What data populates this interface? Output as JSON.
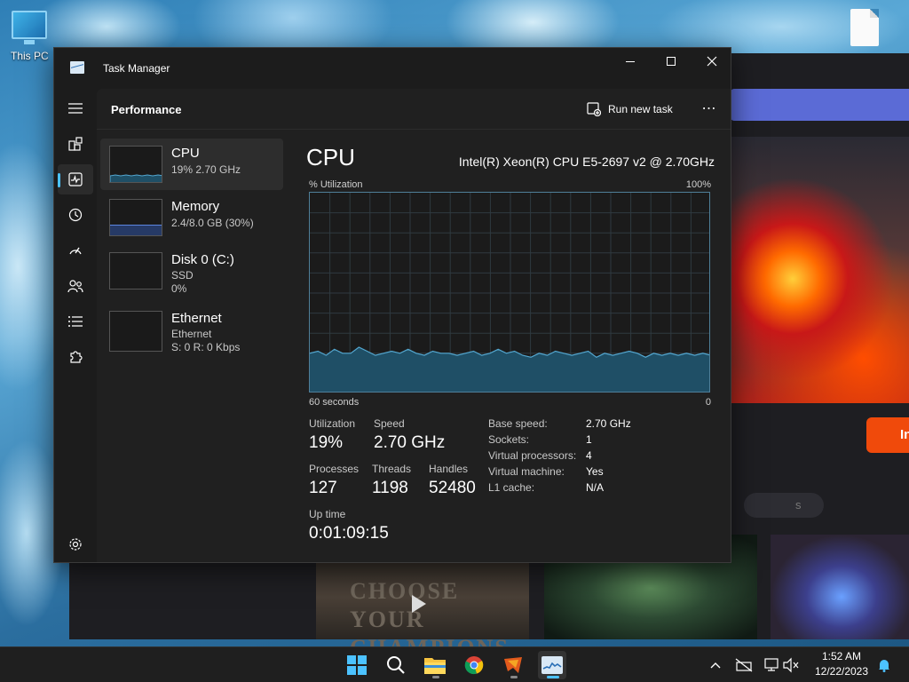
{
  "desktop": {
    "icons": [
      {
        "label": "This PC",
        "icon": "this-pc-icon"
      },
      {
        "label": "",
        "icon": "document-icon"
      }
    ]
  },
  "background_app": {
    "button_label": "In",
    "pill_label": "s",
    "thumbnail_title": "CHOOSE YOUR CHAMPIONS"
  },
  "window": {
    "title": "Task Manager",
    "controls": {
      "minimize": "minimize-icon",
      "maximize": "maximize-icon",
      "close": "close-icon"
    }
  },
  "nav": {
    "items": [
      {
        "name": "hamburger-menu-icon"
      },
      {
        "name": "processes-icon"
      },
      {
        "name": "performance-icon",
        "active": true
      },
      {
        "name": "app-history-icon"
      },
      {
        "name": "startup-apps-icon"
      },
      {
        "name": "users-icon"
      },
      {
        "name": "details-icon"
      },
      {
        "name": "services-icon"
      }
    ],
    "settings": "settings-icon"
  },
  "header": {
    "title": "Performance",
    "run_new_task": "Run new task",
    "more": "⋯"
  },
  "devices": [
    {
      "name": "CPU",
      "line1": "19%  2.70 GHz",
      "line2": ""
    },
    {
      "name": "Memory",
      "line1": "2.4/8.0 GB (30%)",
      "line2": ""
    },
    {
      "name": "Disk 0 (C:)",
      "line1": "SSD",
      "line2": "0%"
    },
    {
      "name": "Ethernet",
      "line1": "Ethernet",
      "line2": "S: 0  R: 0 Kbps"
    }
  ],
  "cpu": {
    "title": "CPU",
    "model": "Intel(R) Xeon(R) CPU E5-2697 v2 @ 2.70GHz",
    "graph": {
      "y_label": "% Utilization",
      "y_max_label": "100%",
      "x_label": "60 seconds",
      "x_min_label": "0",
      "history": [
        20,
        21,
        19,
        22,
        20,
        20,
        23,
        21,
        19,
        20,
        21,
        20,
        22,
        20,
        19,
        21,
        20,
        20,
        19,
        20,
        21,
        19,
        20,
        22,
        20,
        21,
        19,
        18,
        20,
        19,
        21,
        20,
        19,
        20,
        21,
        18,
        20,
        19,
        20,
        21,
        20,
        18,
        20,
        19,
        20,
        19,
        20,
        19,
        20,
        19
      ]
    },
    "stats": {
      "utilization_label": "Utilization",
      "utilization": "19%",
      "speed_label": "Speed",
      "speed": "2.70 GHz",
      "processes_label": "Processes",
      "processes": "127",
      "threads_label": "Threads",
      "threads": "1198",
      "handles_label": "Handles",
      "handles": "52480",
      "uptime_label": "Up time",
      "uptime": "0:01:09:15"
    },
    "details": [
      {
        "key": "Base speed:",
        "value": "2.70 GHz"
      },
      {
        "key": "Sockets:",
        "value": "1"
      },
      {
        "key": "Virtual processors:",
        "value": "4"
      },
      {
        "key": "Virtual machine:",
        "value": "Yes"
      },
      {
        "key": "L1 cache:",
        "value": "N/A"
      }
    ]
  },
  "taskbar": {
    "apps": [
      {
        "name": "start-icon"
      },
      {
        "name": "search-icon"
      },
      {
        "name": "file-explorer-icon"
      },
      {
        "name": "chrome-icon"
      },
      {
        "name": "game-launcher-icon"
      },
      {
        "name": "task-manager-icon",
        "active": true
      }
    ],
    "tray": [
      "chevron-up-icon",
      "network-off-icon",
      "network-icon",
      "notifications-bell-icon"
    ],
    "clock": {
      "time": "1:52 AM",
      "date": "12/22/2023"
    }
  },
  "colors": {
    "accent": "#4cc2ff",
    "graph_line": "#53a7d0",
    "graph_fill": "#1f4f66",
    "window_bg": "#202020"
  }
}
